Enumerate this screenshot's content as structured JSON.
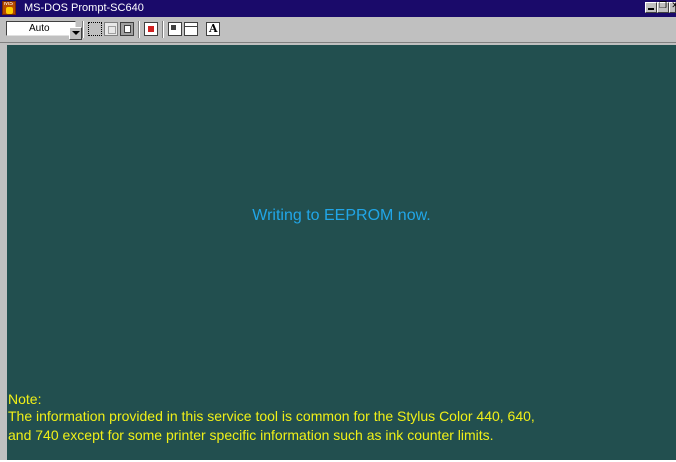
{
  "window": {
    "title": "MS-DOS Prompt-SC640",
    "icon": "ms-dos-icon",
    "icon_text": "MS",
    "controls": [
      "minimize",
      "maximize",
      "close"
    ]
  },
  "toolbar": {
    "font_size_value": "Auto",
    "icons": [
      "mark-icon",
      "copy-icon",
      "paste-icon",
      "full-screen-icon",
      "properties-icon",
      "background-icon",
      "font-icon"
    ],
    "font_button_label": "A"
  },
  "console": {
    "background_color": "#224f4f",
    "message": "Writing to EEPROM now.",
    "message_color": "#21a6e8",
    "note_label": "Note:",
    "note_lines": [
      "The information provided in this service tool is common for the Stylus Color 440, 640,",
      "and 740 except for some printer specific information such as ink counter limits."
    ],
    "note_color": "#f0f018"
  }
}
